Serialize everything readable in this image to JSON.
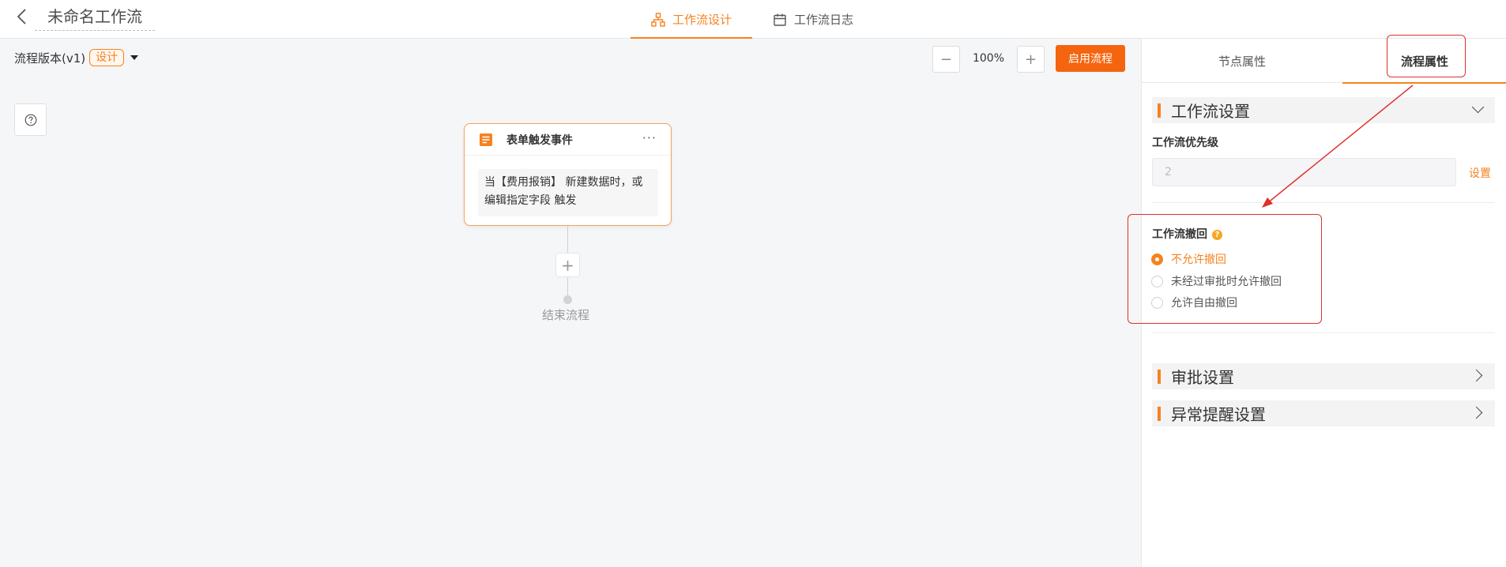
{
  "header": {
    "title": "未命名工作流",
    "tabs": [
      {
        "label": "工作流设计",
        "icon": "workflow-icon",
        "active": true
      },
      {
        "label": "工作流日志",
        "icon": "calendar-icon",
        "active": false
      }
    ]
  },
  "canvas": {
    "version_label": "流程版本(v1)",
    "version_badge": "设计",
    "zoom_minus": "−",
    "zoom_level": "100%",
    "zoom_plus": "+",
    "start_button": "启用流程",
    "node": {
      "title": "表单触发事件",
      "more": "···",
      "description": "当【费用报销】 新建数据时，或编辑指定字段 触发"
    },
    "add_symbol": "+",
    "end_label": "结束流程"
  },
  "panel": {
    "tabs": [
      {
        "label": "节点属性",
        "active": false
      },
      {
        "label": "流程属性",
        "active": true
      }
    ],
    "workflow_settings": {
      "title": "工作流设置",
      "priority_label": "工作流优先级",
      "priority_value": "2",
      "set_link": "设置",
      "recall_label": "工作流撤回",
      "recall_help": "?",
      "recall_options": [
        {
          "label": "不允许撤回",
          "selected": true
        },
        {
          "label": "未经过审批时允许撤回",
          "selected": false
        },
        {
          "label": "允许自由撤回",
          "selected": false
        }
      ]
    },
    "approval_settings": {
      "title": "审批设置"
    },
    "alert_settings": {
      "title": "异常提醒设置"
    }
  },
  "colors": {
    "accent": "#f5821f",
    "start_button": "#f5650f",
    "annotation": "#e0312a"
  }
}
